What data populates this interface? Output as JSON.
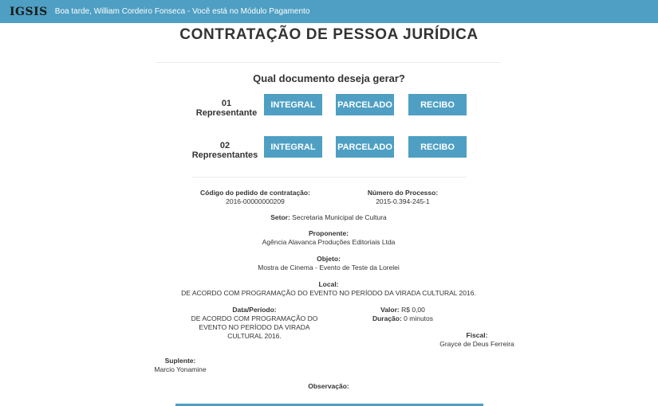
{
  "header": {
    "logo": "IGSIS",
    "greeting": "Boa tarde, William Cordeiro Fonseca - Você está no Módulo Pagamento"
  },
  "page_title": "CONTRATAÇÃO DE PESSOA JURÍDICA",
  "question": "Qual documento deseja gerar?",
  "rows": [
    {
      "num": "01",
      "label": "Representante",
      "buttons": [
        "INTEGRAL",
        "PARCELADO",
        "RECIBO"
      ]
    },
    {
      "num": "02",
      "label": "Representantes",
      "buttons": [
        "INTEGRAL",
        "PARCELADO",
        "RECIBO"
      ]
    }
  ],
  "details": {
    "codigo_label": "Código do pedido de contratação:",
    "codigo_value": "2016-00000000209",
    "processo_label": "Número do Processo:",
    "processo_value": "2015-0.394-245-1",
    "setor_label": "Setor:",
    "setor_value": "Secretaria Municipal de Cultura",
    "proponente_label": "Proponente:",
    "proponente_value": "Agência Alavanca Produções Editoriais Ltda",
    "objeto_label": "Objeto:",
    "objeto_value": "Mostra de Cinema - Evento de Teste da Lorelei",
    "local_label": "Local:",
    "local_value": "DE ACORDO COM PROGRAMAÇÃO DO EVENTO NO PERÍODO DA VIRADA CULTURAL 2016.",
    "data_label": "Data/Período:",
    "data_line1": "DE ACORDO COM PROGRAMAÇÃO DO",
    "data_line2": "EVENTO NO PERÍODO DA VIRADA",
    "data_line3": "CULTURAL 2016.",
    "valor_label": "Valor:",
    "valor_value": "R$ 0,00",
    "duracao_label": "Duração:",
    "duracao_value": "0 minutos",
    "fiscal_label": "Fiscal:",
    "fiscal_value": "Grayce de Deus Ferreira",
    "suplente_label": "Suplente:",
    "suplente_value": "Marcio Yonamine",
    "observacao_label": "Observação:"
  },
  "colors": {
    "accent": "#4e9fc3"
  }
}
